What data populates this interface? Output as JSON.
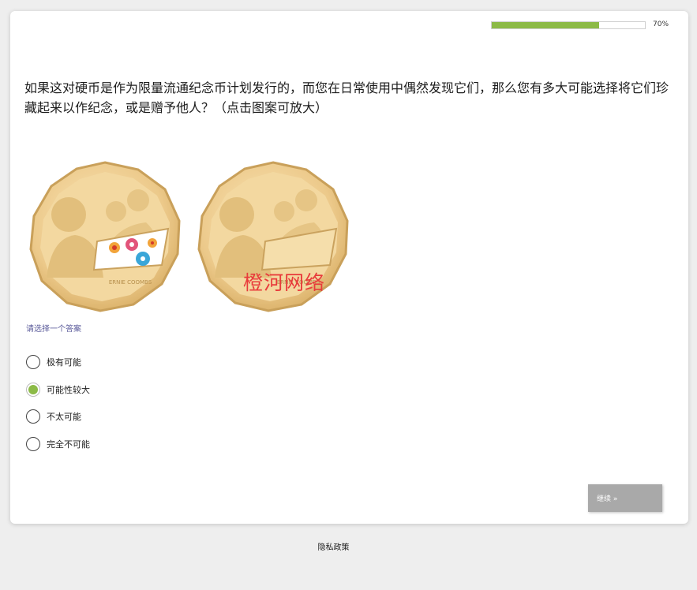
{
  "progress": {
    "percent": 70,
    "label": "70%"
  },
  "question": {
    "text": "如果这对硬币是作为限量流通纪念币计划发行的，而您在日常使用中偶然发现它们，那么您有多大可能选择将它们珍藏起来以作纪念，或是赠予他人？（点击图案可放大）"
  },
  "coins": {
    "inscription": "ERNIE COOMBS",
    "watermark": "橙河网络"
  },
  "instruction": "请选择一个答案",
  "options": [
    {
      "label": "极有可能",
      "selected": false
    },
    {
      "label": "可能性较大",
      "selected": true
    },
    {
      "label": "不太可能",
      "selected": false
    },
    {
      "label": "完全不可能",
      "selected": false
    }
  ],
  "continue_label": "继续 »",
  "footer": {
    "privacy_label": "隐私政策"
  },
  "colors": {
    "accent": "#8cba47",
    "button": "#a9a9a9"
  }
}
